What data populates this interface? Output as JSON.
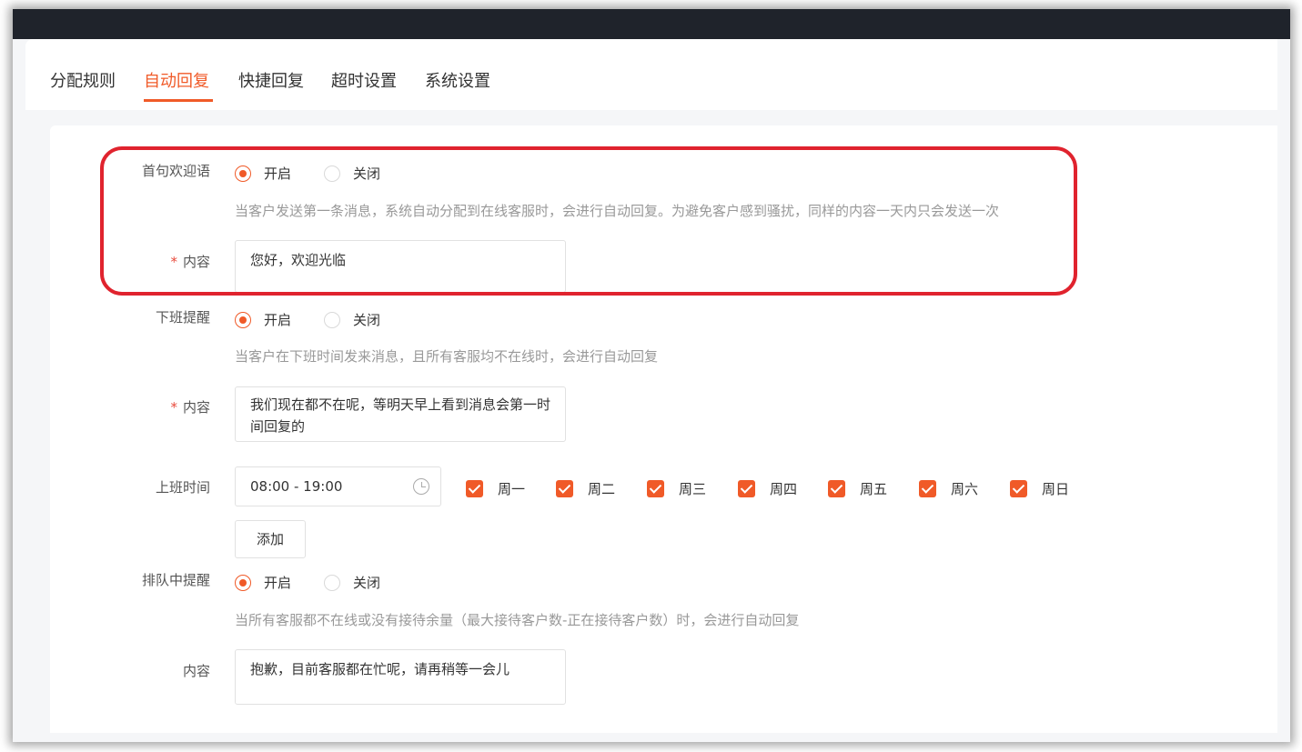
{
  "tabs": [
    {
      "label": "分配规则",
      "active": false
    },
    {
      "label": "自动回复",
      "active": true
    },
    {
      "label": "快捷回复",
      "active": false
    },
    {
      "label": "超时设置",
      "active": false
    },
    {
      "label": "系统设置",
      "active": false
    }
  ],
  "welcome": {
    "label": "首句欢迎语",
    "on_label": "开启",
    "off_label": "关闭",
    "selected": "开启",
    "hint": "当客户发送第一条消息，系统自动分配到在线客服时，会进行自动回复。为避免客户感到骚扰，同样的内容一天内只会发送一次",
    "content_label": "内容",
    "content_required_mark": "*",
    "content_value": "您好，欢迎光临"
  },
  "offwork": {
    "label": "下班提醒",
    "on_label": "开启",
    "off_label": "关闭",
    "selected": "开启",
    "hint": "当客户在下班时间发来消息，且所有客服均不在线时，会进行自动回复",
    "content_label": "内容",
    "content_required_mark": "*",
    "content_value": "我们现在都不在呢，等明天早上看到消息会第一时间回复的"
  },
  "worktime": {
    "label": "上班时间",
    "time_range": "08:00 - 19:00",
    "days": [
      {
        "label": "周一",
        "checked": true
      },
      {
        "label": "周二",
        "checked": true
      },
      {
        "label": "周三",
        "checked": true
      },
      {
        "label": "周四",
        "checked": true
      },
      {
        "label": "周五",
        "checked": true
      },
      {
        "label": "周六",
        "checked": true
      },
      {
        "label": "周日",
        "checked": true
      }
    ],
    "add_label": "添加"
  },
  "queue": {
    "label": "排队中提醒",
    "on_label": "开启",
    "off_label": "关闭",
    "selected": "开启",
    "hint": "当所有客服都不在线或没有接待余量（最大接待客户数-正在接待客户数）时，会进行自动回复",
    "content_label": "内容",
    "content_value": "抱歉，目前客服都在忙呢，请再稍等一会儿"
  },
  "colors": {
    "accent": "#f05a28",
    "highlight": "#e0232e",
    "topbar": "#1f232b"
  }
}
